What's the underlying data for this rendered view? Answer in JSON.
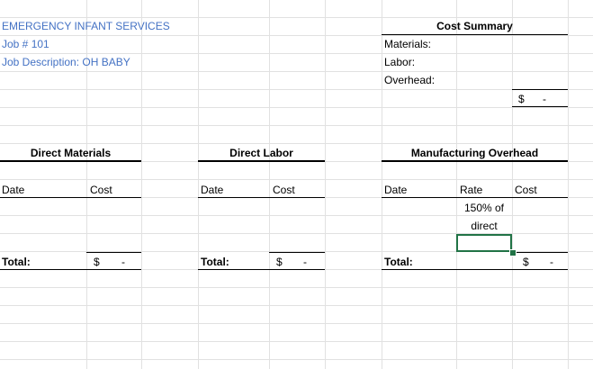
{
  "header": {
    "company": "EMERGENCY INFANT SERVICES",
    "job_number": "Job # 101",
    "job_description": "Job Description: OH BABY"
  },
  "cost_summary": {
    "title": "Cost Summary",
    "materials_label": "Materials:",
    "labor_label": "Labor:",
    "overhead_label": "Overhead:",
    "total_currency": "$",
    "total_value": "-"
  },
  "direct_materials": {
    "title": "Direct Materials",
    "date_header": "Date",
    "cost_header": "Cost",
    "total_label": "Total:",
    "total_currency": "$",
    "total_value": "-"
  },
  "direct_labor": {
    "title": "Direct Labor",
    "date_header": "Date",
    "cost_header": "Cost",
    "total_label": "Total:",
    "total_currency": "$",
    "total_value": "-"
  },
  "manufacturing_overhead": {
    "title": "Manufacturing Overhead",
    "date_header": "Date",
    "rate_header": "Rate",
    "cost_header": "Cost",
    "rate_line1": "150% of",
    "rate_line2": "direct",
    "total_label": "Total:",
    "total_currency": "$",
    "total_value": "-"
  },
  "colors": {
    "header_text": "#4472c4",
    "gridline": "#e1e1e1",
    "selection": "#217346"
  }
}
